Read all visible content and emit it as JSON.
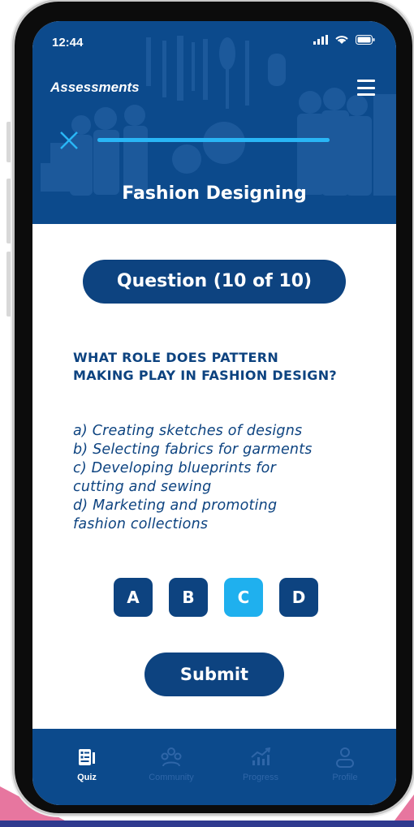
{
  "status_bar": {
    "time": "12:44"
  },
  "header": {
    "title": "Assessments",
    "subject": "Fashion Designing",
    "progress_fraction": 1.0
  },
  "quiz": {
    "counter": "Question (10 of 10)",
    "question": "WHAT ROLE DOES PATTERN MAKING PLAY IN FASHION DESIGN?",
    "options": [
      "a) Creating sketches of designs",
      "b) Selecting fabrics for garments",
      "c) Developing blueprints for",
      "cutting and sewing",
      "d) Marketing and promoting",
      "fashion collections"
    ],
    "answers": [
      "A",
      "B",
      "C",
      "D"
    ],
    "selected_answer": "C",
    "submit_label": "Submit"
  },
  "bottom_nav": [
    {
      "label": "Quiz",
      "icon": "quiz-icon",
      "active": true
    },
    {
      "label": "Community",
      "icon": "community-icon",
      "active": false
    },
    {
      "label": "Progress",
      "icon": "progress-chart-icon",
      "active": false
    },
    {
      "label": "Profile",
      "icon": "profile-icon",
      "active": false
    }
  ],
  "colors": {
    "primary": "#0d4380",
    "header_bg": "#0c4a8c",
    "accent": "#1fb0ee",
    "inactive_nav": "#2f66a8"
  }
}
